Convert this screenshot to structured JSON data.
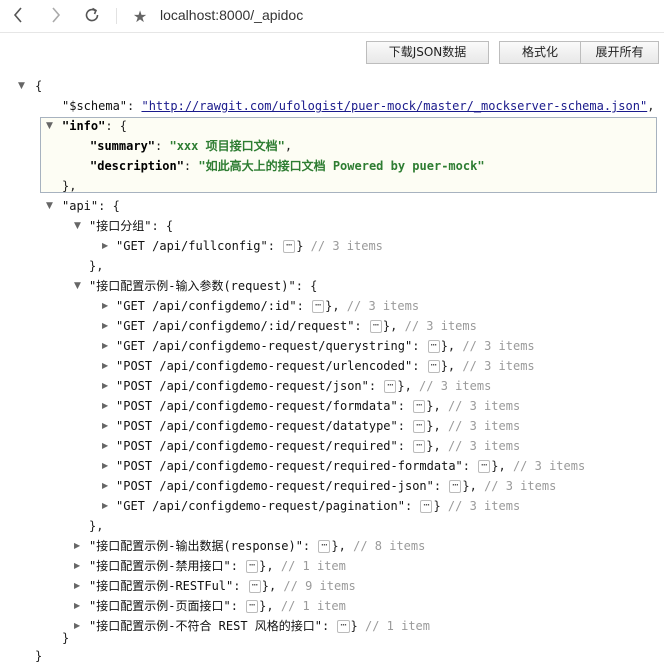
{
  "browser": {
    "url": "localhost:8000/_apidoc"
  },
  "toolbar": {
    "download_label": "下载JSON数据",
    "format_label": "格式化",
    "expand_label": "展开所有"
  },
  "json": {
    "schema_key": "\"$schema\"",
    "schema_value": "\"http://rawgit.com/ufologist/puer-mock/master/_mockserver-schema.json\"",
    "info_key": "\"info\"",
    "summary_key": "\"summary\"",
    "summary_value": "\"xxx 项目接口文档\"",
    "description_key": "\"description\"",
    "description_value": "\"如此高大上的接口文档 Powered by puer-mock\"",
    "api_key": "\"api\"",
    "group1_key": "\"接口分组\"",
    "fullconfig_key": "\"GET /api/fullconfig\"",
    "fullconfig_comment": "// 3 items",
    "group2_key": "\"接口配置示例-输入参数(request)\"",
    "request_items": [
      {
        "key": "\"GET /api/configdemo/:id\"",
        "comment": "// 3 items"
      },
      {
        "key": "\"GET /api/configdemo/:id/request\"",
        "comment": "// 3 items"
      },
      {
        "key": "\"GET /api/configdemo-request/querystring\"",
        "comment": "// 3 items"
      },
      {
        "key": "\"POST /api/configdemo-request/urlencoded\"",
        "comment": "// 3 items"
      },
      {
        "key": "\"POST /api/configdemo-request/json\"",
        "comment": "// 3 items"
      },
      {
        "key": "\"POST /api/configdemo-request/formdata\"",
        "comment": "// 3 items"
      },
      {
        "key": "\"POST /api/configdemo-request/datatype\"",
        "comment": "// 3 items"
      },
      {
        "key": "\"POST /api/configdemo-request/required\"",
        "comment": "// 3 items"
      },
      {
        "key": "\"POST /api/configdemo-request/required-formdata\"",
        "comment": "// 3 items"
      },
      {
        "key": "\"POST /api/configdemo-request/required-json\"",
        "comment": "// 3 items"
      },
      {
        "key": "\"GET /api/configdemo-request/pagination\"",
        "comment": "// 3 items"
      }
    ],
    "collapsed_groups": [
      {
        "key": "\"接口配置示例-输出数据(response)\"",
        "comment": "// 8 items"
      },
      {
        "key": "\"接口配置示例-禁用接口\"",
        "comment": "// 1 item"
      },
      {
        "key": "\"接口配置示例-RESTFul\"",
        "comment": "// 9 items"
      },
      {
        "key": "\"接口配置示例-页面接口\"",
        "comment": "// 1 item"
      },
      {
        "key": "\"接口配置示例-不符合 REST 风格的接口\"",
        "comment": "// 1 item"
      }
    ]
  }
}
